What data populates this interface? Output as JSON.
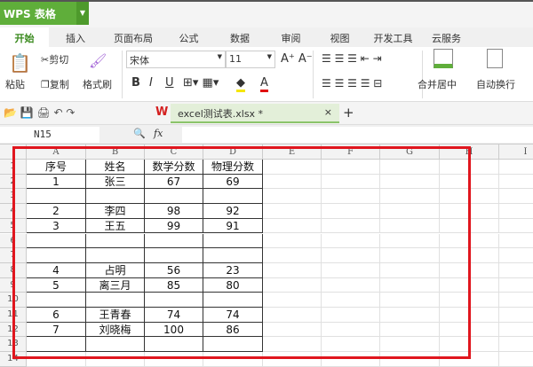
{
  "app": {
    "title": "WPS 表格"
  },
  "tabs": [
    "开始",
    "插入",
    "页面布局",
    "公式",
    "数据",
    "审阅",
    "视图",
    "开发工具",
    "云服务"
  ],
  "ribbon": {
    "paste": "粘贴",
    "cut": "剪切",
    "copy": "复制",
    "format_painter": "格式刷",
    "font": "宋体",
    "font_size": "11",
    "merge_center": "合并居中",
    "wrap_text": "自动换行"
  },
  "document": {
    "tab_label": "excel测试表.xlsx *"
  },
  "formula_bar": {
    "name_box": "N15",
    "fx": "fx",
    "value": ""
  },
  "sheet": {
    "columns": [
      "A",
      "B",
      "C",
      "D",
      "E",
      "F",
      "G",
      "H",
      "I"
    ],
    "rows": [
      [
        "序号",
        "姓名",
        "数学分数",
        "物理分数"
      ],
      [
        "1",
        "张三",
        "67",
        "69"
      ],
      [
        "",
        "",
        "",
        ""
      ],
      [
        "2",
        "李四",
        "98",
        "92"
      ],
      [
        "3",
        "王五",
        "99",
        "91"
      ],
      [
        "",
        "",
        "",
        ""
      ],
      [
        "",
        "",
        "",
        ""
      ],
      [
        "4",
        "占明",
        "56",
        "23"
      ],
      [
        "5",
        "离三月",
        "85",
        "80"
      ],
      [
        "",
        "",
        "",
        ""
      ],
      [
        "6",
        "王青春",
        "74",
        "74"
      ],
      [
        "7",
        "刘晓梅",
        "100",
        "86"
      ],
      [
        "",
        "",
        "",
        ""
      ],
      [
        "",
        "",
        "",
        ""
      ]
    ]
  },
  "colors": {
    "accent": "#5fae3a",
    "highlight_border": "#e0161e"
  }
}
